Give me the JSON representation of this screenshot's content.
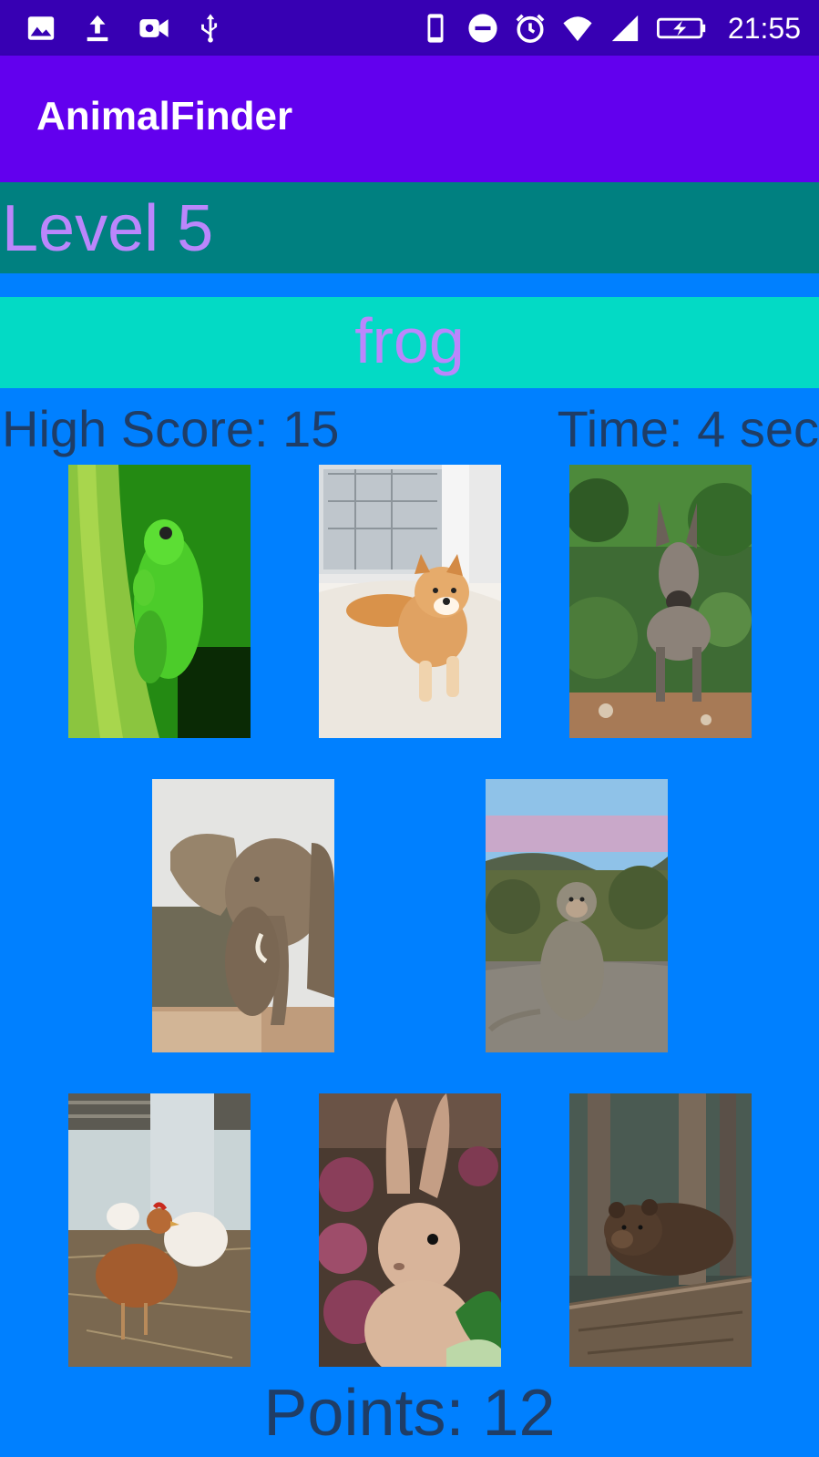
{
  "status_bar": {
    "time": "21:55",
    "left_icons": [
      "image-icon",
      "upload-icon",
      "video-icon",
      "usb-icon"
    ],
    "right_icons": [
      "phone-icon",
      "do-not-disturb-icon",
      "alarm-icon",
      "wifi-icon",
      "signal-icon",
      "battery-charging-icon"
    ]
  },
  "app": {
    "title": "AnimalFinder"
  },
  "game": {
    "level_label": "Level 5",
    "target_word": "frog",
    "high_score_label": "High Score: 15",
    "time_label": "Time: 4 sec",
    "points_label": "Points: 12"
  },
  "animals": [
    "frog",
    "dog",
    "donkey",
    "elephant",
    "monkey",
    "chicken",
    "rabbit",
    "bear"
  ],
  "colors": {
    "status_bar": "#3700b3",
    "app_bar": "#6200ee",
    "level_bar": "#008080",
    "target_bar": "#03dac5",
    "background": "#0080ff",
    "accent_text": "#bb86fc",
    "score_text": "#1f3d66"
  }
}
